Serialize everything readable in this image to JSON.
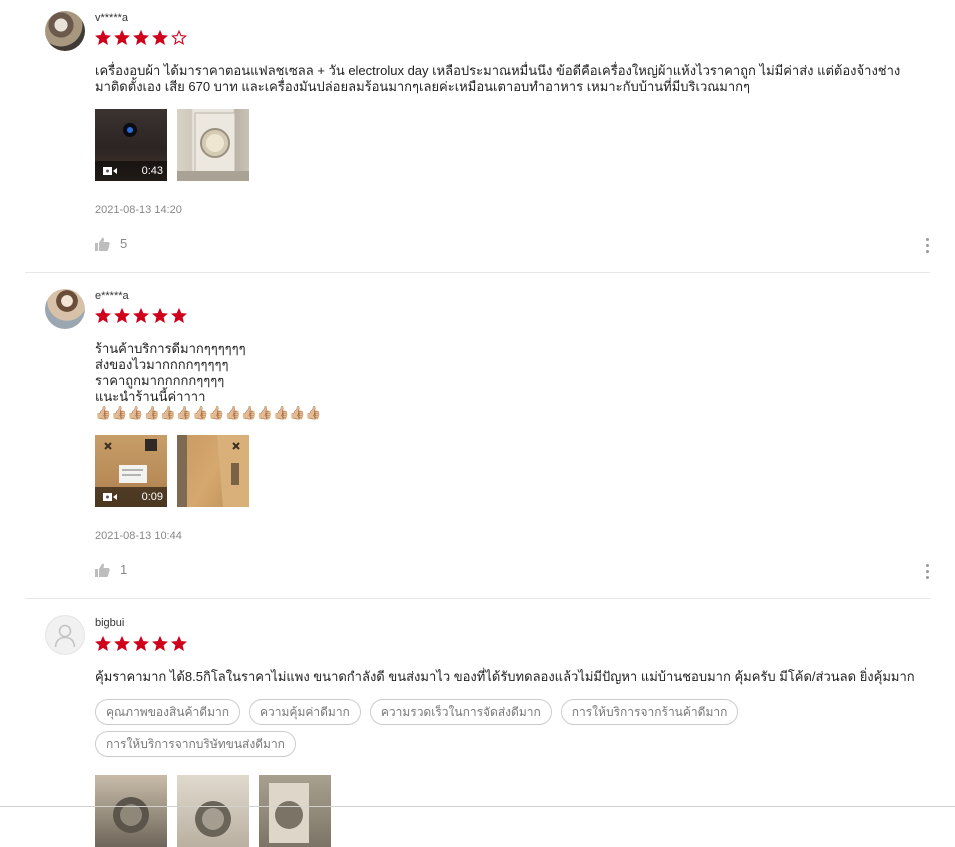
{
  "reviews": [
    {
      "username": "v*****a",
      "rating": 4,
      "text": "เครื่องอบผ้า ได้มาราคาตอนแฟลชเซลล + วัน electrolux day เหลือประมาณหมื่นนึง ข้อดีคือเครื่องใหญ่ผ้าแห้งไวราคาถูก ไม่มีค่าส่ง แต่ต้องจ้างช่าง\nมาติดตั้งเอง เสีย 670 บาท และเครื่องมันปล่อยลมร้อนมากๆเลยค่ะเหมือนเตาอบทำอาหาร เหมาะกับบ้านที่มีบริเวณมากๆ",
      "video_duration": "0:43",
      "date": "2021-08-13 14:20",
      "likes": "5"
    },
    {
      "username": "e*****a",
      "rating": 5,
      "text": "ร้านค้าบริการดีมากๆๆๆๆๆๆ\nส่งของไวมากกกกๆๆๆๆๆ\nราคาถูกมากกกกกๆๆๆๆ\nแนะนำร้านนี้ค่าาาา\n👍🏼👍🏼👍🏼👍🏼👍🏼👍🏼👍🏼👍🏼👍🏼👍🏼👍🏼👍🏼👍🏼👍🏼",
      "video_duration": "0:09",
      "date": "2021-08-13 10:44",
      "likes": "1"
    },
    {
      "username": "bigbui",
      "rating": 5,
      "text": "คุ้มราคามาก ได้8.5กิโลในราคาไม่แพง ขนาดกำลังดี ขนส่งมาไว ของที่ได้รับทดลองแล้วไม่มีปัญหา แม่บ้านชอบมาก คุ้มครับ มีโค้ด/ส่วนลด ยิ่งคุ้มมาก",
      "tags": [
        "คุณภาพของสินค้าดีมาก",
        "ความคุ้มค่าดีมาก",
        "ความรวดเร็วในการจัดส่งดีมาก",
        "การให้บริการจากร้านค้าดีมาก",
        "การให้บริการจากบริษัทขนส่งดีมาก"
      ]
    }
  ],
  "colors": {
    "star": "#d0011b",
    "meta": "#888888"
  },
  "icons": {
    "like": "thumb-up-icon",
    "more": "more-vertical-icon",
    "video": "video-camera-icon",
    "avatar_placeholder": "user-icon"
  }
}
